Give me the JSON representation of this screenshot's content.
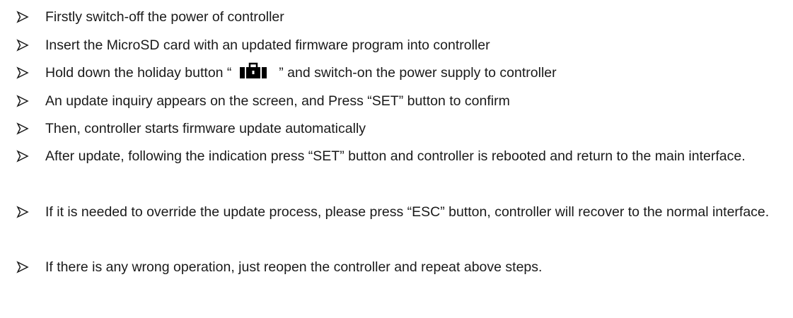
{
  "steps": [
    {
      "text": "Firstly switch-off the power of controller"
    },
    {
      "text": "Insert the MicroSD card with an updated firmware program into controller"
    },
    {
      "before": "Hold down the holiday button “",
      "icon": "suitcase-icon",
      "after": "” and switch-on the power supply to controller"
    },
    {
      "text": "An update inquiry appears on the screen, and Press “SET” button to confirm"
    },
    {
      "text": "Then, controller starts firmware update automatically"
    },
    {
      "text": "After update, following the indication press “SET” button and controller is rebooted and return to the main interface."
    },
    {
      "text": "If it is needed to override the update process, please press “ESC” button, controller will recover to the normal interface."
    },
    {
      "text": "If there is any wrong operation, just reopen the controller and repeat above steps."
    }
  ]
}
